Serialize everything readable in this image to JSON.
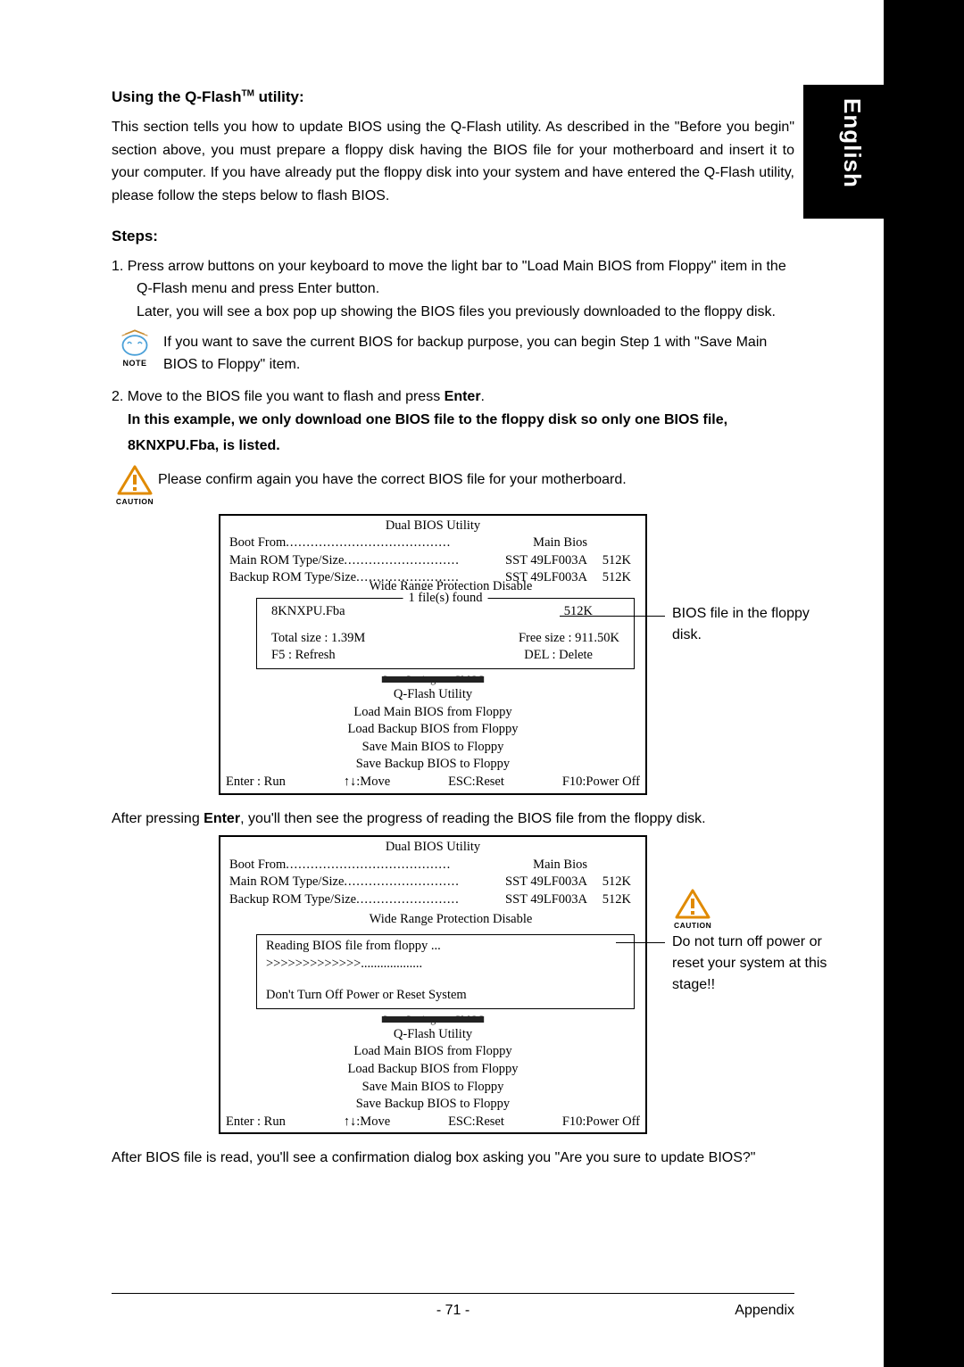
{
  "sideTab": "English",
  "heading1_pre": "Using the Q-Flash",
  "heading1_tm": "TM",
  "heading1_post": " utility:",
  "intro": "This section tells you how to update BIOS using the Q-Flash utility. As described in the \"Before you begin\" section above, you must prepare a floppy disk having the BIOS file for your motherboard and insert it to your computer. If you have already put the floppy disk into your system and have entered the Q-Flash utility, please follow the steps below to flash BIOS.",
  "stepsHeading": "Steps:",
  "step1_a": "1.    Press arrow buttons on your keyboard to move the light bar to \"Load Main BIOS from Floppy\" item in the Q-Flash menu and press Enter button.",
  "step1_b": "Later, you will see a box pop up showing the BIOS files you previously downloaded to the floppy disk.",
  "note1": "If you want to save the current BIOS for backup purpose, you can begin Step 1 with \"Save Main BIOS to Floppy\" item.",
  "noteLabel": "NOTE",
  "cautionLabel": "CAUTION",
  "step2_pre": "2. Move to the BIOS file you want to flash and press ",
  "step2_enter": "Enter",
  "step2_post": ".",
  "step2_bold": "In this example, we only download one BIOS file to the floppy disk so only one BIOS file, 8KNXPU.Fba, is listed.",
  "caution1": "Please confirm again you have the correct BIOS file for your motherboard.",
  "bios": {
    "title": "Dual BIOS Utility",
    "bootFromLabel": "Boot From",
    "bootFromVal": "Main Bios",
    "mainRomLabel": "Main ROM Type/Size",
    "mainRomVal": "SST 49LF003A",
    "mainRomSize": "512K",
    "backupRomLabel": "Backup ROM Type/Size",
    "backupRomVal": "SST 49LF003A",
    "backupRomSize": "512K",
    "protect": "Wide Range Protection    Disable",
    "filesFound": "1 file(s) found",
    "fileName": "8KNXPU.Fba",
    "fileSize": "512K",
    "totalSize": "Total size : 1.39M",
    "freeSize": "Free size : 911.50K",
    "f5": "F5 : Refresh",
    "del": "DEL : Delete",
    "obscured": "Save Settings to CMOS",
    "qflash": "Q-Flash Utility",
    "m1": "Load Main BIOS from Floppy",
    "m2": "Load Backup BIOS from Floppy",
    "m3": "Save Main BIOS to Floppy",
    "m4": "Save Backup BIOS to Floppy",
    "enter": "Enter : Run",
    "move": "↑↓:Move",
    "esc": "ESC:Reset",
    "f10": "F10:Power Off",
    "reading": "Reading BIOS file from floppy ...",
    "progress": ">>>>>>>>>>>>>...................",
    "dontTurn": "Don't Turn Off Power or Reset System"
  },
  "annot1": "BIOS file in the floppy disk.",
  "afterEnter_pre": "After pressing ",
  "afterEnter_enter": "Enter",
  "afterEnter_post": ", you'll then see the progress of reading the BIOS file from the floppy disk.",
  "annot2": "Do not turn off power or reset your system at this stage!!",
  "afterRead": "After BIOS file is read, you'll see a confirmation dialog box asking you \"Are you sure to update BIOS?\"",
  "pageNum": "- 71 -",
  "appendix": "Appendix"
}
